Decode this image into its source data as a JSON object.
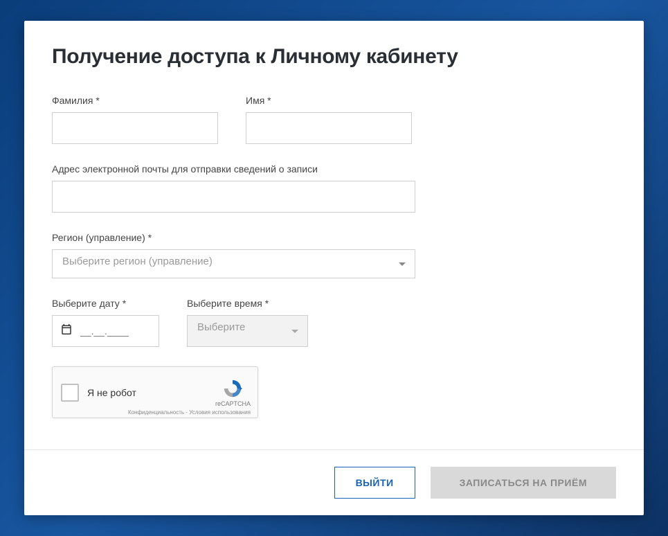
{
  "modal": {
    "title": "Получение доступа к Личному кабинету"
  },
  "form": {
    "lastname_label": "Фамилия *",
    "lastname_value": "",
    "firstname_label": "Имя *",
    "firstname_value": "",
    "email_label": "Адрес электронной почты для отправки сведений о записи",
    "email_value": "",
    "region_label": "Регион (управление) *",
    "region_placeholder": "Выберите регион (управление)",
    "date_label": "Выберите дату *",
    "date_placeholder": "__.__.____",
    "time_label": "Выберите время *",
    "time_placeholder": "Выберите"
  },
  "recaptcha": {
    "label": "Я не робот",
    "brand": "reCAPTCHA",
    "terms": "Конфиденциальность - Условия использования"
  },
  "footer": {
    "cancel_label": "ВЫЙТИ",
    "submit_label": "ЗАПИСАТЬСЯ НА ПРИЁМ"
  }
}
